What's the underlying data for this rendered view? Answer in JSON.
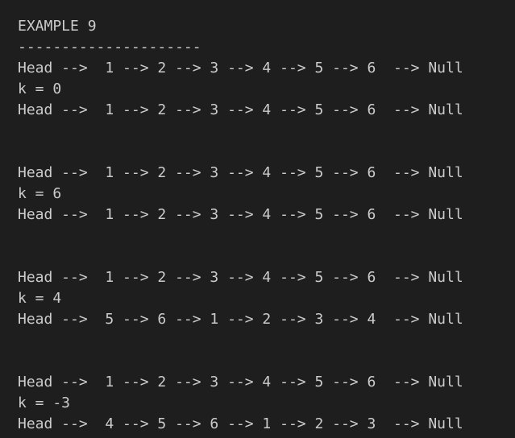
{
  "terminal": {
    "title": "EXAMPLE 9",
    "separator": "---------------------",
    "lines": [
      "Head -->  1 --> 2 --> 3 --> 4 --> 5 --> 6  --> Null",
      "k = 0",
      "Head -->  1 --> 2 --> 3 --> 4 --> 5 --> 6  --> Null",
      "",
      "",
      "Head -->  1 --> 2 --> 3 --> 4 --> 5 --> 6  --> Null",
      "k = 6",
      "Head -->  1 --> 2 --> 3 --> 4 --> 5 --> 6  --> Null",
      "",
      "",
      "Head -->  1 --> 2 --> 3 --> 4 --> 5 --> 6  --> Null",
      "k = 4",
      "Head -->  5 --> 6 --> 1 --> 2 --> 3 --> 4  --> Null",
      "",
      "",
      "Head -->  1 --> 2 --> 3 --> 4 --> 5 --> 6  --> Null",
      "k = -3",
      "Head -->  4 --> 5 --> 6 --> 1 --> 2 --> 3  --> Null"
    ]
  }
}
